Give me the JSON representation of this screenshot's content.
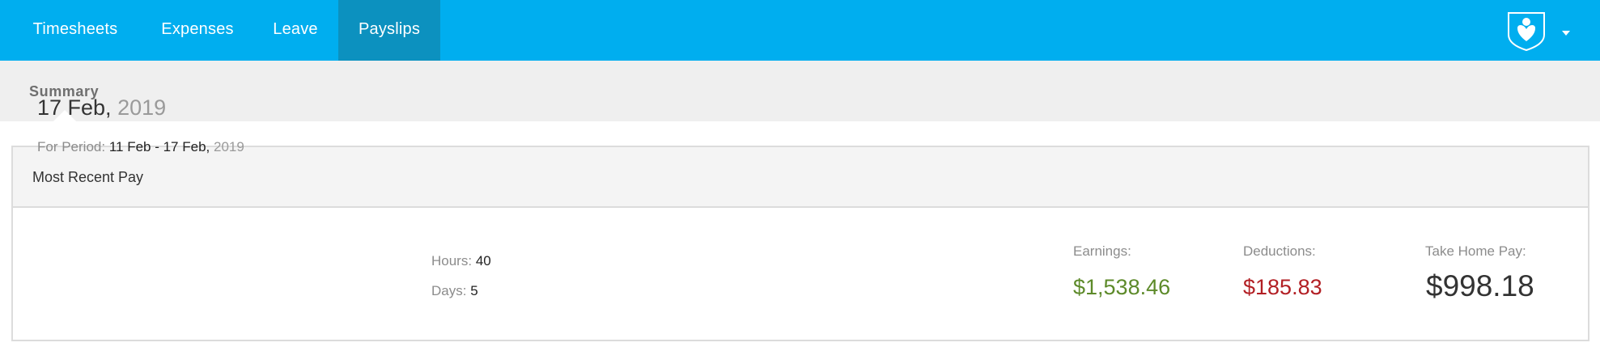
{
  "nav": {
    "tabs": [
      {
        "label": "Timesheets"
      },
      {
        "label": "Expenses"
      },
      {
        "label": "Leave"
      },
      {
        "label": "Payslips",
        "active": true
      }
    ],
    "brand_color": "#00aeef",
    "active_tab_color": "#0c91bf"
  },
  "profile": {
    "icon": "shield-heart-icon",
    "menu_icon": "caret-down-icon"
  },
  "subnav": {
    "items": [
      {
        "label": "Summary",
        "active": true
      }
    ]
  },
  "recent_pay": {
    "title": "Most Recent Pay",
    "pay_date": {
      "day_month": "17 Feb,",
      "year": "2019"
    },
    "period": {
      "label": "For Period:",
      "range": "11 Feb - 17 Feb,",
      "year": "2019"
    },
    "hours": {
      "label": "Hours:",
      "value": "40"
    },
    "days": {
      "label": "Days:",
      "value": "5"
    },
    "earnings": {
      "label": "Earnings:",
      "value": "$1,538.46",
      "color": "#5d8a2a"
    },
    "deductions": {
      "label": "Deductions:",
      "value": "$185.83",
      "color": "#b21f24"
    },
    "take_home": {
      "label": "Take Home Pay:",
      "value": "$998.18"
    }
  }
}
